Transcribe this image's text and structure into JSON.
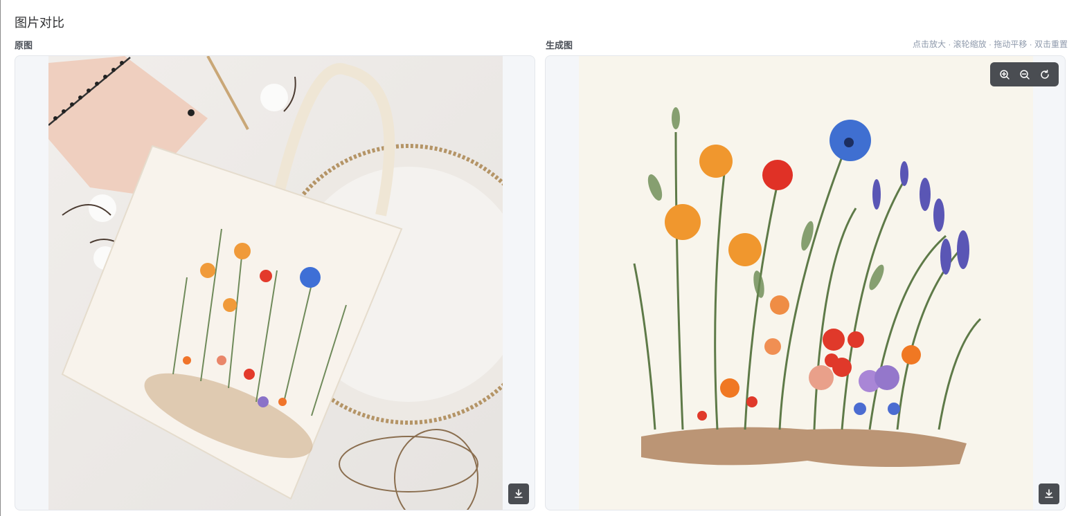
{
  "page": {
    "title": "图片对比"
  },
  "original": {
    "label": "原图"
  },
  "generated": {
    "label": "生成图"
  },
  "hint": "点击放大 · 滚轮缩放 · 拖动平移 · 双击重置",
  "icons": {
    "download": "download-icon",
    "zoom_in": "zoom-in-icon",
    "zoom_out": "zoom-out-icon",
    "reset": "reset-icon"
  },
  "colors": {
    "panel_bg": "#f4f6f9",
    "button_bg": "#4a4d52",
    "hint": "#8e99ab"
  }
}
